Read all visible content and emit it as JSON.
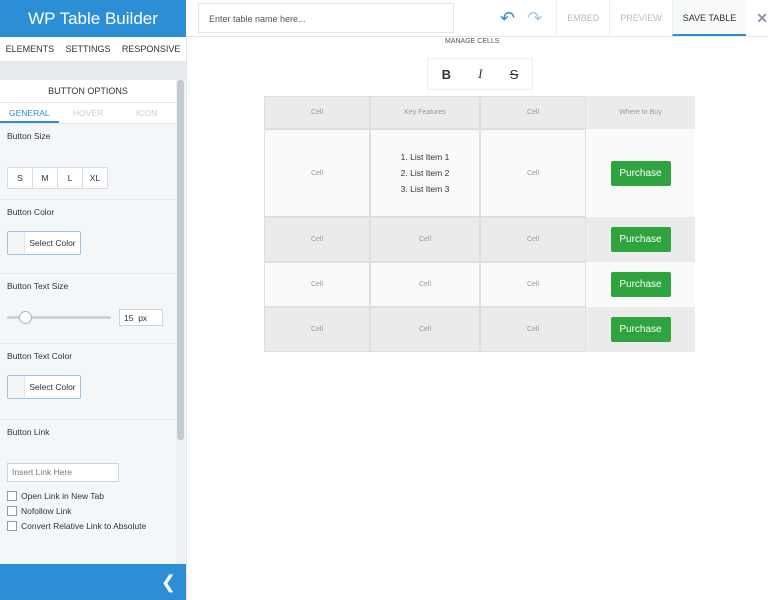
{
  "sidebar": {
    "brand": "WP Table Builder",
    "tabs": [
      "ELEMENTS",
      "SETTINGS",
      "RESPONSIVE"
    ],
    "panel_title": "BUTTON OPTIONS",
    "panel_tabs": [
      "GENERAL",
      "HOVER",
      "ICON"
    ],
    "button_size_label": "Button Size",
    "sizes": [
      "S",
      "M",
      "L",
      "XL"
    ],
    "button_color_label": "Button Color",
    "select_color": "Select Color",
    "text_size_label": "Button Text Size",
    "text_size_value": "15",
    "text_size_unit": "px",
    "text_color_label": "Button Text Color",
    "link_label": "Button Link",
    "link_placeholder": "Insert Link Here",
    "checks": [
      "Open Link in New Tab",
      "Nofollow Link",
      "Convert Relative Link to Absolute"
    ]
  },
  "toolbar": {
    "name_placeholder": "Enter table name here...",
    "embed": "EMBED",
    "preview": "PREVIEW",
    "save": "SAVE TABLE"
  },
  "manage_cells": "MANAGE CELLS",
  "format": {
    "bold": "B",
    "italic": "I",
    "strike": "S"
  },
  "table": {
    "cell": "Cell",
    "headers": [
      "Key Features",
      "Where to Buy"
    ],
    "list_items": [
      "1. List Item 1",
      "2. List Item 2",
      "3. List Item 3"
    ],
    "button": "Purchase"
  }
}
